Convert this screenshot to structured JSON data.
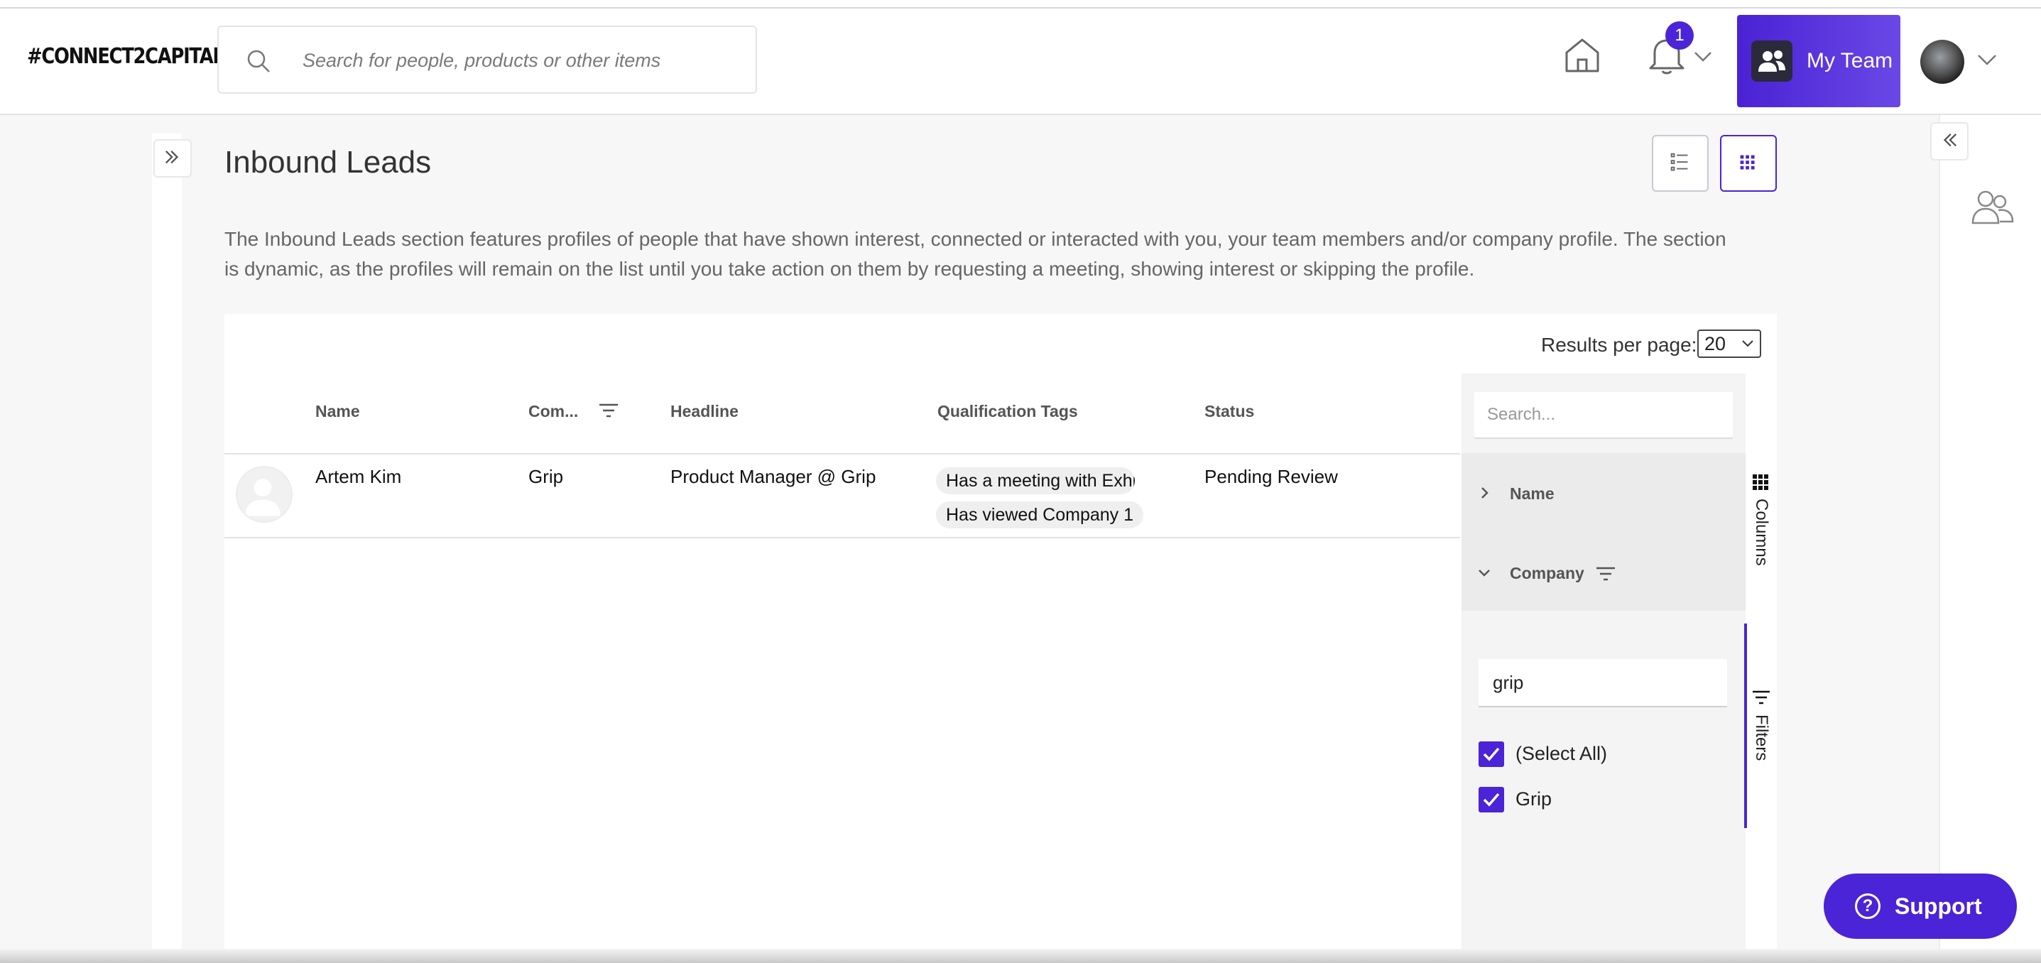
{
  "header": {
    "logo": "#CONNECT2CAPITAL",
    "search_placeholder": "Search for people, products or other items",
    "notification_count": "1",
    "my_team_label": "My Team"
  },
  "page": {
    "title": "Inbound Leads",
    "description": "The Inbound Leads section features profiles of people that have shown interest, connected or interacted with you, your team members and/or company profile. The section is dynamic, as the profiles will remain on the list until you take action on them by requesting a meeting, showing interest or skipping the profile."
  },
  "grid": {
    "results_per_page_label": "Results per page:",
    "results_per_page_value": "20",
    "columns": [
      "Name",
      "Com...",
      "Headline",
      "Qualification Tags",
      "Status"
    ],
    "rows": [
      {
        "name": "Artem Kim",
        "company": "Grip",
        "headline": "Product Manager @ Grip",
        "tags": [
          "Has a meeting with Exhibitor",
          "Has viewed Company 1"
        ],
        "status": "Pending Review"
      }
    ]
  },
  "side_panel": {
    "search_placeholder": "Search...",
    "column_items": [
      "Name",
      "Company"
    ],
    "filter_value": "grip",
    "checkboxes": [
      "(Select All)",
      "Grip"
    ],
    "tabs": [
      "Columns",
      "Filters"
    ]
  },
  "support": {
    "label": "Support"
  },
  "colors": {
    "accent": "#4a24d6"
  }
}
